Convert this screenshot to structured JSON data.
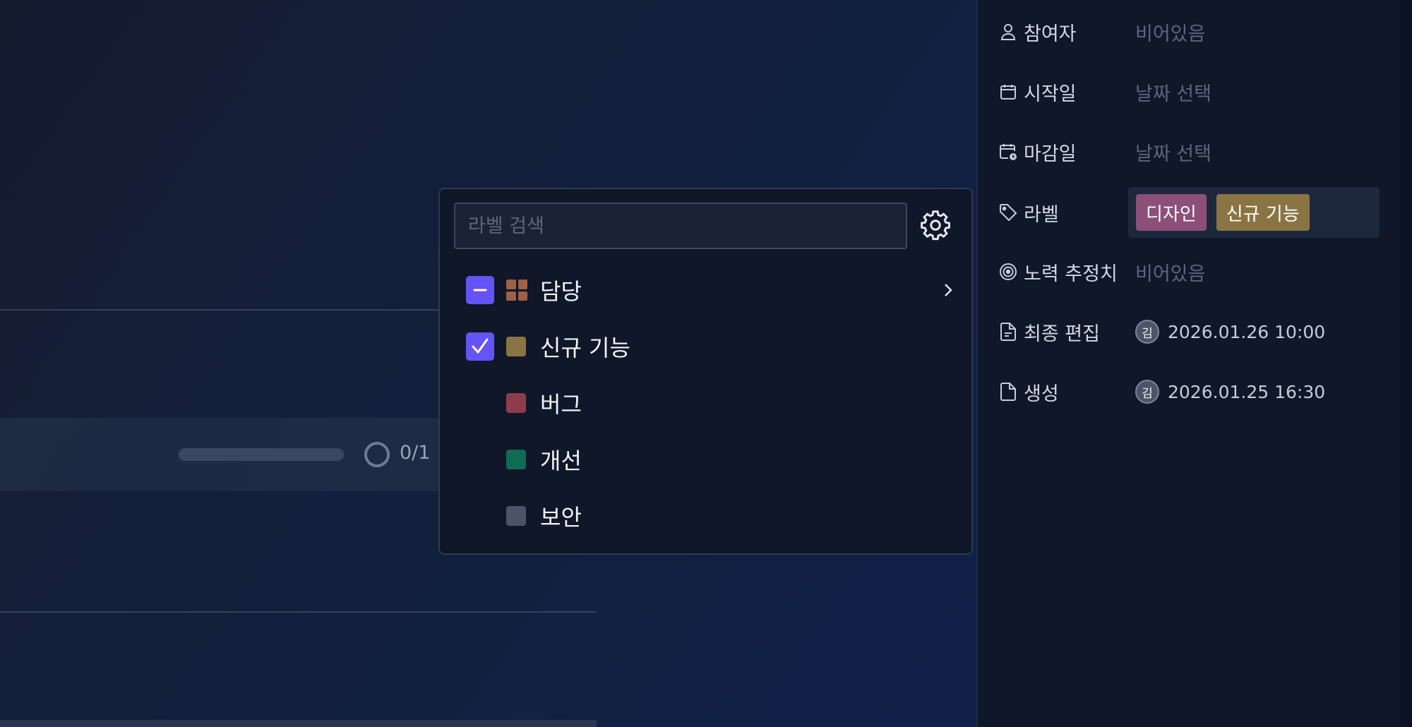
{
  "task": {
    "progress": 0.0,
    "progress_text": "0/1"
  },
  "label_dropdown": {
    "search_placeholder": "라벨 검색",
    "options": [
      {
        "label": "담당",
        "state": "partial",
        "color": "#9c6147",
        "kind": "group",
        "icon": "grid-icon"
      },
      {
        "label": "신규 기능",
        "state": "checked",
        "color": "#8b7444",
        "kind": "label"
      },
      {
        "label": "버그",
        "state": "none",
        "color": "#8e3c4a",
        "kind": "label"
      },
      {
        "label": "개선",
        "state": "none",
        "color": "#0f6b52",
        "kind": "label"
      },
      {
        "label": "보안",
        "state": "none",
        "color": "#4b5366",
        "kind": "label"
      }
    ]
  },
  "properties": {
    "participants": {
      "label": "참여자",
      "value": "비어있음",
      "icon": "person-icon"
    },
    "start_date": {
      "label": "시작일",
      "value": "날짜 선택",
      "icon": "calendar-icon"
    },
    "due_date": {
      "label": "마감일",
      "value": "날짜 선택",
      "icon": "calendar-clock-icon"
    },
    "labels": {
      "label": "라벨",
      "icon": "tag-icon",
      "chips": [
        {
          "text": "디자인",
          "color": "#8c4f78"
        },
        {
          "text": "신규 기능",
          "color": "#8b7444"
        }
      ]
    },
    "estimate": {
      "label": "노력 추정치",
      "value": "비어있음",
      "icon": "target-icon"
    },
    "last_edited": {
      "label": "최종 편집",
      "avatar": "김",
      "value": "2026.01.26 10:00",
      "icon": "document-edit-icon"
    },
    "created": {
      "label": "생성",
      "avatar": "김",
      "value": "2026.01.25 16:30",
      "icon": "document-icon"
    }
  },
  "colors": {
    "accent": "#6454f6",
    "panel": "#0f1729"
  }
}
